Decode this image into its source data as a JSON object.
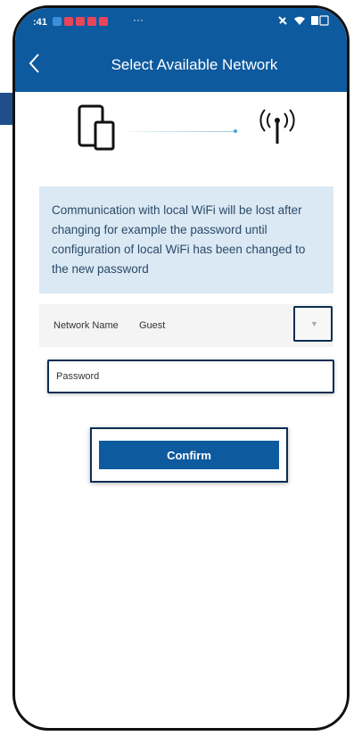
{
  "status_bar": {
    "time": ":41",
    "more": "···",
    "notification_colors": [
      "#3b8fd9",
      "#e8455b",
      "#e8455b",
      "#e8455b",
      "#e8455b"
    ],
    "icons": [
      "mute-icon",
      "wifi-icon",
      "battery-icon"
    ]
  },
  "header": {
    "title": "Select Available Network",
    "back_icon": "chevron-left-icon"
  },
  "diagram": {
    "device_icon": "phone-tablet-icon",
    "antenna_icon": "wifi-antenna-icon"
  },
  "info": {
    "message": "Communication with local WiFi will be lost after changing for example the password until configuration of local WiFi has been changed to the new password"
  },
  "network": {
    "label": "Network Name",
    "value": "Guest",
    "dropdown_icon": "caret-down-icon"
  },
  "password": {
    "placeholder": "Password",
    "value": ""
  },
  "actions": {
    "confirm_label": "Confirm"
  },
  "colors": {
    "primary": "#0e5a9e",
    "highlight_border": "#0b2d52",
    "info_background": "#dbe9f5",
    "annotation_arrow": "#1f4e8a"
  }
}
